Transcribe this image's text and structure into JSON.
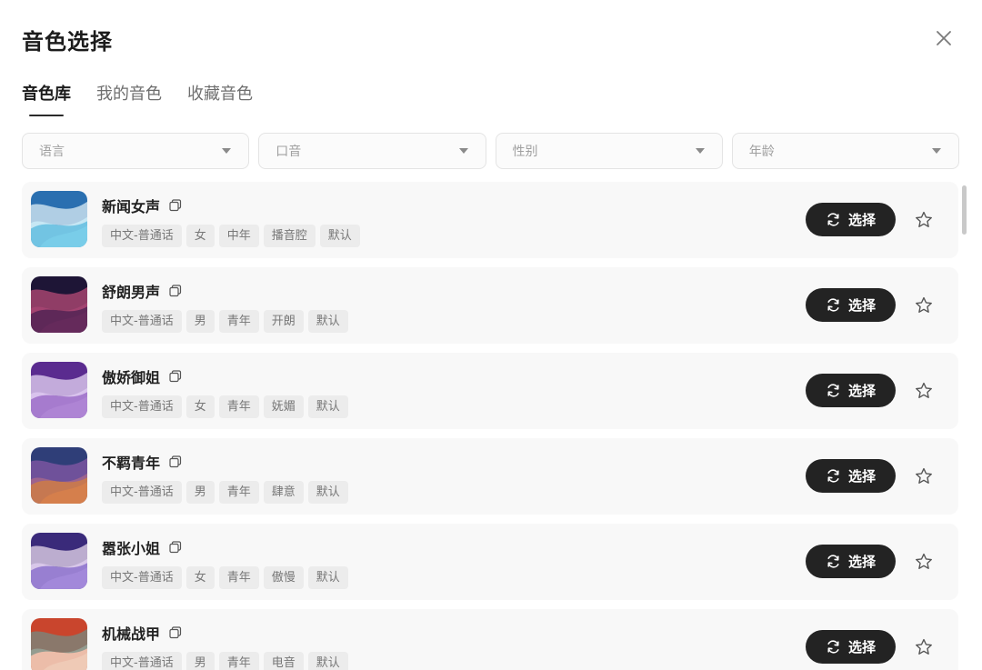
{
  "dialog": {
    "title": "音色选择",
    "close_icon": "close-icon"
  },
  "tabs": [
    {
      "label": "音色库",
      "active": true
    },
    {
      "label": "我的音色",
      "active": false
    },
    {
      "label": "收藏音色",
      "active": false
    }
  ],
  "filters": [
    {
      "label": "语言",
      "icon": "chevron-down-icon"
    },
    {
      "label": "口音",
      "icon": "chevron-down-icon"
    },
    {
      "label": "性别",
      "icon": "chevron-down-icon"
    },
    {
      "label": "年龄",
      "icon": "chevron-down-icon"
    }
  ],
  "voices": [
    {
      "name": "新闻女声",
      "tags": [
        "中文-普通话",
        "女",
        "中年",
        "播音腔",
        "默认"
      ],
      "select_label": "选择",
      "thumb_colors": [
        "#2a6fb0",
        "#7fd3ec",
        "#e9f6fb"
      ]
    },
    {
      "name": "舒朗男声",
      "tags": [
        "中文-普通话",
        "男",
        "青年",
        "开朗",
        "默认"
      ],
      "select_label": "选择",
      "thumb_colors": [
        "#1e1536",
        "#6a2c5e",
        "#c04f7a"
      ]
    },
    {
      "name": "傲娇御姐",
      "tags": [
        "中文-普通话",
        "女",
        "青年",
        "妩媚",
        "默认"
      ],
      "select_label": "选择",
      "thumb_colors": [
        "#5a2b8f",
        "#b48ad9",
        "#efe3fb"
      ]
    },
    {
      "name": "不羁青年",
      "tags": [
        "中文-普通话",
        "男",
        "青年",
        "肆意",
        "默认"
      ],
      "select_label": "选择",
      "thumb_colors": [
        "#2f3e78",
        "#e0834a",
        "#8a5aa8"
      ]
    },
    {
      "name": "嚣张小姐",
      "tags": [
        "中文-普通话",
        "女",
        "青年",
        "傲慢",
        "默认"
      ],
      "select_label": "选择",
      "thumb_colors": [
        "#3a2a7a",
        "#a98ee0",
        "#f3e6f4"
      ]
    },
    {
      "name": "机械战甲",
      "tags": [
        "中文-普通话",
        "男",
        "青年",
        "电音",
        "默认"
      ],
      "select_label": "选择",
      "thumb_colors": [
        "#c9452d",
        "#f2d2bf",
        "#6f8f86"
      ]
    }
  ]
}
